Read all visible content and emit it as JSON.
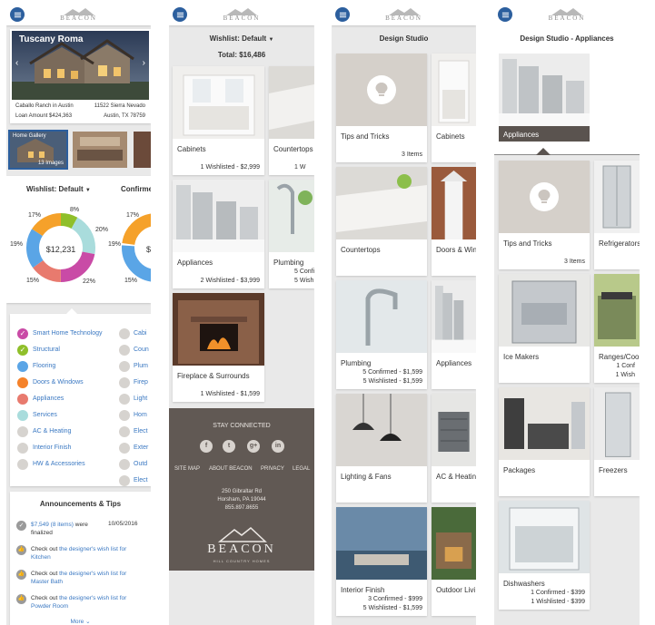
{
  "brand": {
    "logo_text": "BEACON",
    "footer_logo": "BEACON",
    "footer_tagline": "HILL COUNTRY HOMES"
  },
  "colors": {
    "accent": "#2c5f9e",
    "link": "#3a78c2",
    "footer": "#615954",
    "overlay": "#5a534f"
  },
  "screen1": {
    "hero_title": "Tuscany Roma",
    "community": "Caballo Ranch in Austin",
    "address1": "11522 Sierra Nevado",
    "loan": "Loan Amount $424,363",
    "address2": "Austin, TX 78759",
    "thumb_label": "Home Gallery",
    "thumb_count": "13 Images",
    "wishlist_label": "Wishlist:",
    "wishlist_value": "Default",
    "confirmed_label": "Confirme",
    "donut_total": "$12,231",
    "donut2_total": "$9",
    "pct": [
      "8%",
      "20%",
      "22%",
      "15%",
      "19%",
      "17%"
    ],
    "pct2": [
      "17%",
      "19%",
      "15%"
    ],
    "categories": [
      {
        "label": "Smart Home Technology",
        "color": "#c94ba6",
        "check": true
      },
      {
        "label": "Structural",
        "color": "#8fbf2a",
        "check": true
      },
      {
        "label": "Flooring",
        "color": "#5aa5e6",
        "check": false
      },
      {
        "label": "Doors & Windows",
        "color": "#f5822a",
        "check": false
      },
      {
        "label": "Appliances",
        "color": "#e87a6e",
        "check": false
      },
      {
        "label": "Services",
        "color": "#a9dcdc",
        "check": false
      },
      {
        "label": "AC & Heating",
        "color": "#d6d3cf",
        "check": false
      },
      {
        "label": "Interior Finish",
        "color": "#d6d3cf",
        "check": false
      },
      {
        "label": "HW & Accessories",
        "color": "#d6d3cf",
        "check": false
      }
    ],
    "categories2": [
      "Cabi",
      "Coun",
      "Plum",
      "Firep",
      "Light",
      "Hom",
      "Elect",
      "Exter",
      "Outd",
      "Elect"
    ],
    "announcements_title": "Announcements & Tips",
    "ann1_link": "$7,549 (8 items)",
    "ann1_text": "were finalized",
    "ann1_date": "10/05/2016",
    "ann2_pre": "Check out",
    "ann2_link": "the designer's wish list for Kitchen",
    "ann3_pre": "Check out",
    "ann3_link": "the designer's wish list for Master Bath",
    "ann4_pre": "Check out",
    "ann4_link": "the designer's wish list for Powder Room",
    "more": "More"
  },
  "screen2": {
    "wishlist_label": "Wishlist:",
    "wishlist_value": "Default",
    "total": "Total: $16,486",
    "tiles": [
      {
        "title": "Cabinets",
        "meta1": "1 Wishlisted - $2,999",
        "meta2": ""
      },
      {
        "title": "Countertops",
        "meta1": "1 W",
        "meta2": ""
      },
      {
        "title": "Appliances",
        "meta1": "2 Wishlisted - $3,999",
        "meta2": ""
      },
      {
        "title": "Plumbing",
        "meta1": "5 Confi",
        "meta2": "5 Wish"
      },
      {
        "title": "Fireplace & Surrounds",
        "meta1": "1 Wishlisted - $1,599",
        "meta2": ""
      }
    ],
    "stay_connected": "STAY CONNECTED",
    "social": [
      "f",
      "t",
      "g+",
      "in"
    ],
    "links": [
      "SITE MAP",
      "ABOUT BEACON",
      "PRIVACY",
      "LEGAL"
    ],
    "addr1": "250 Gibraltar Rd",
    "addr2": "Horsham, PA 19044",
    "phone": "855.897.8655"
  },
  "screen3": {
    "title": "Design Studio",
    "tiles": [
      {
        "title": "Tips and Tricks",
        "meta1": "3 Items",
        "meta2": ""
      },
      {
        "title": "Cabinets",
        "meta1": "",
        "meta2": ""
      },
      {
        "title": "Countertops",
        "meta1": "",
        "meta2": ""
      },
      {
        "title": "Doors & Win",
        "meta1": "",
        "meta2": ""
      },
      {
        "title": "Plumbing",
        "meta1": "5 Confirmed - $1,599",
        "meta2": "5 Wishlisted - $1,599"
      },
      {
        "title": "Appliances",
        "meta1": "",
        "meta2": ""
      },
      {
        "title": "Lighting & Fans",
        "meta1": "",
        "meta2": ""
      },
      {
        "title": "AC & Heatin",
        "meta1": "",
        "meta2": ""
      },
      {
        "title": "Interior Finish",
        "meta1": "3 Confirmed - $999",
        "meta2": "5 Wishlisted - $1,599"
      },
      {
        "title": "Outdoor Livi",
        "meta1": "",
        "meta2": ""
      }
    ]
  },
  "screen4": {
    "title": "Design Studio - Appliances",
    "selected": "Appliances",
    "tiles": [
      {
        "title": "Tips and Tricks",
        "meta1": "3 Items",
        "meta2": ""
      },
      {
        "title": "Refrigerators",
        "meta1": "",
        "meta2": ""
      },
      {
        "title": "Ice Makers",
        "meta1": "",
        "meta2": ""
      },
      {
        "title": "Ranges/Cool",
        "meta1": "1 Conf",
        "meta2": "1 Wish"
      },
      {
        "title": "Packages",
        "meta1": "",
        "meta2": ""
      },
      {
        "title": "Freezers",
        "meta1": "",
        "meta2": ""
      },
      {
        "title": "Dishwashers",
        "meta1": "1 Confirmed - $399",
        "meta2": "1 Wishlisted - $399"
      }
    ]
  }
}
